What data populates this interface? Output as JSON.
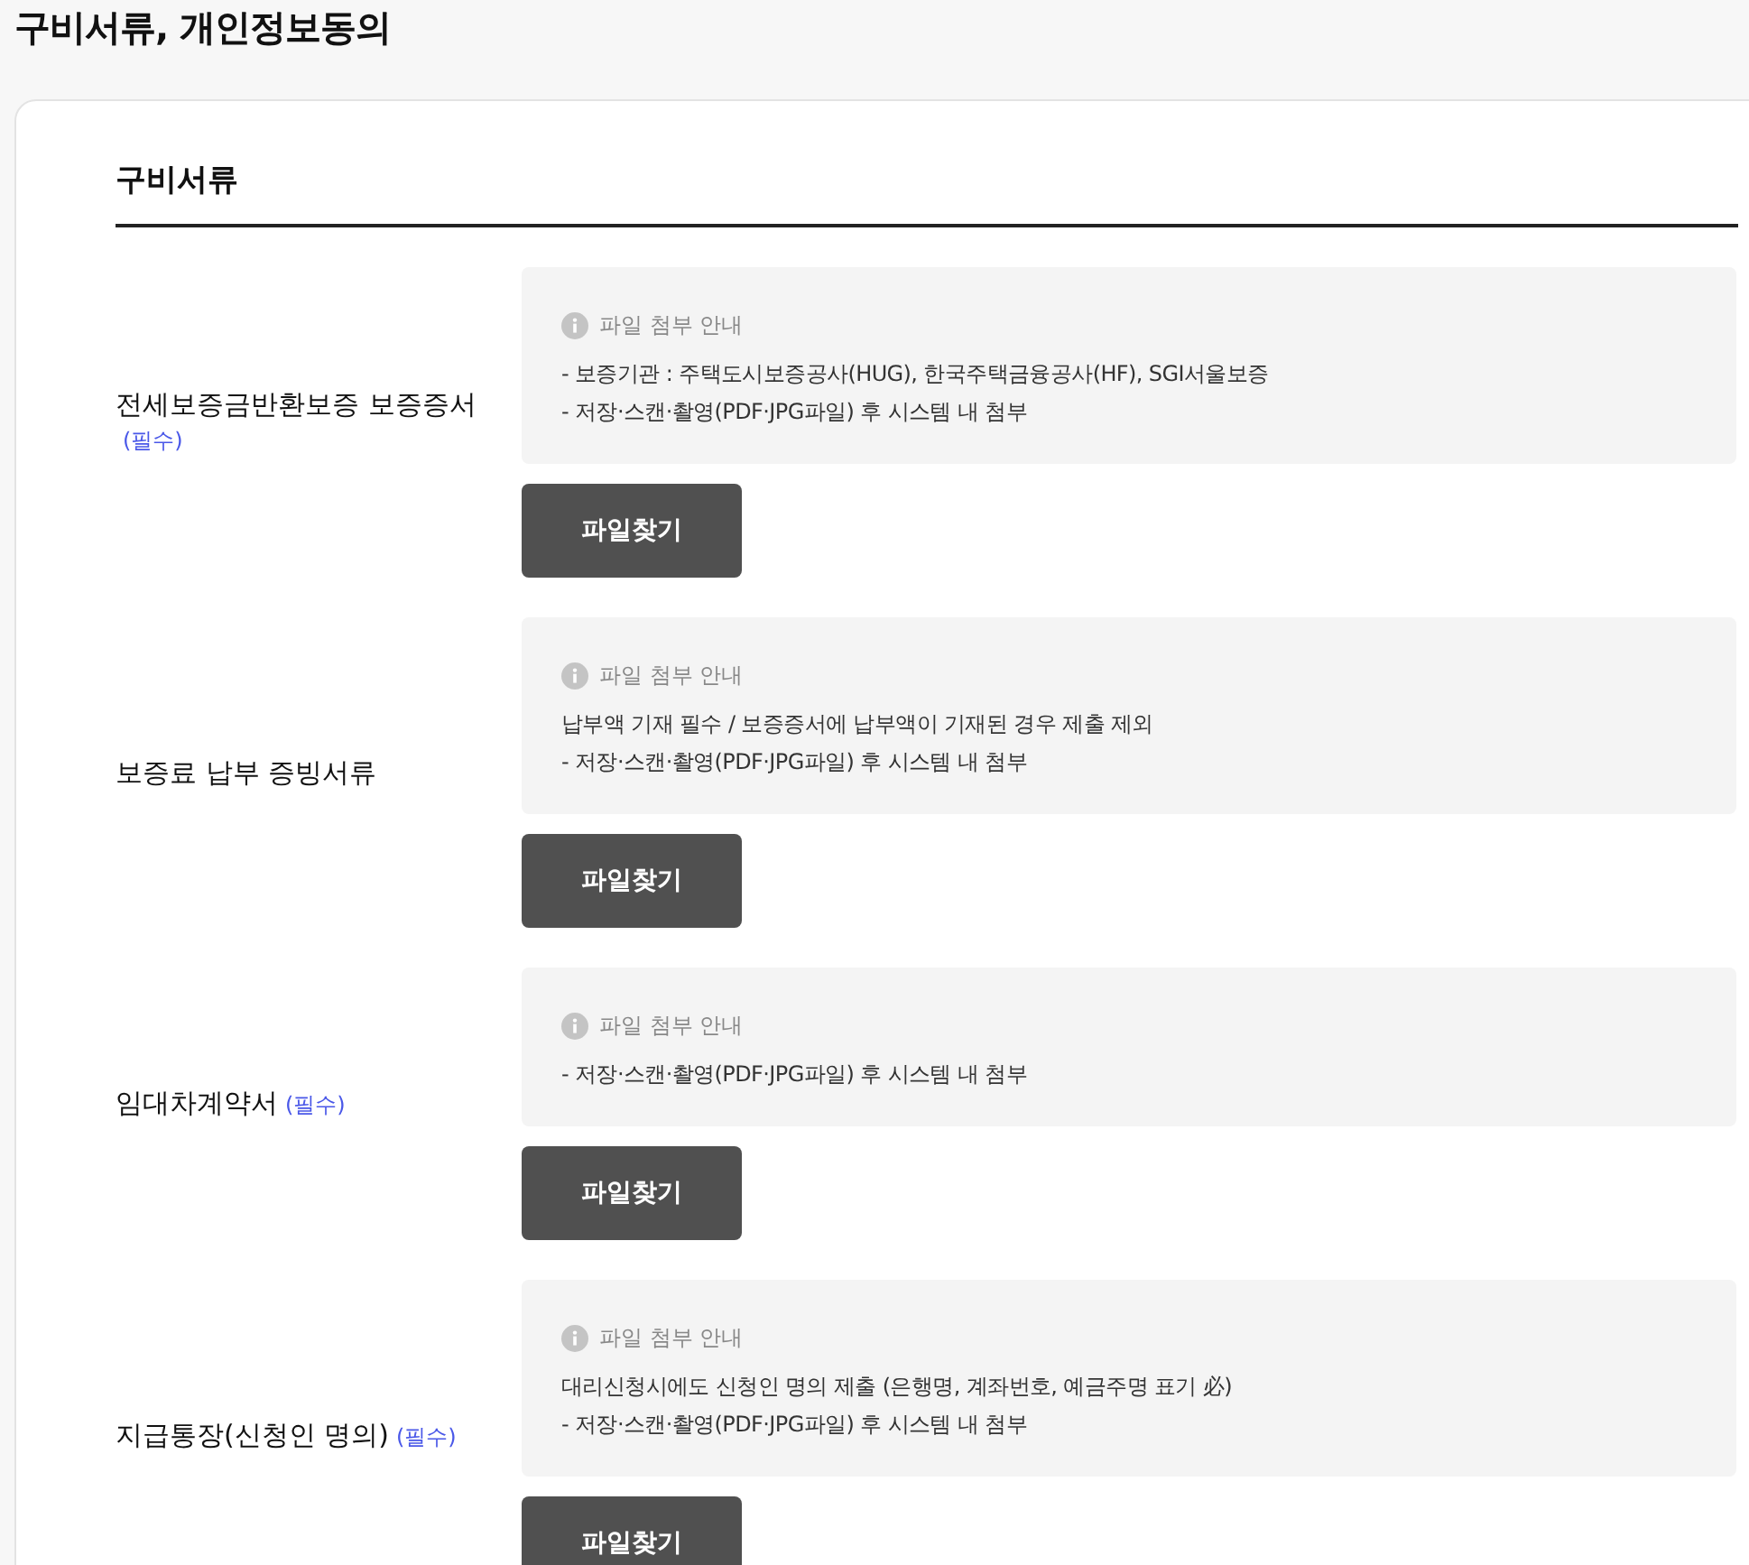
{
  "page_title": "구비서류, 개인정보동의",
  "section": {
    "title": "구비서류",
    "documents": [
      {
        "label": "전세보증금반환보증 보증증서",
        "required_mark": "(필수)",
        "notice": {
          "title": "파일 첨부 안내",
          "lines": [
            "- 보증기관 : 주택도시보증공사(HUG), 한국주택금융공사(HF), SGI서울보증",
            "- 저장·스캔·촬영(PDF·JPG파일) 후 시스템 내 첨부"
          ]
        },
        "button": "파일찾기"
      },
      {
        "label": "보증료 납부 증빙서류",
        "notice": {
          "title": "파일 첨부 안내",
          "lines": [
            "납부액 기재 필수 / 보증증서에 납부액이 기재된 경우 제출 제외",
            "- 저장·스캔·촬영(PDF·JPG파일) 후 시스템 내 첨부"
          ]
        },
        "button": "파일찾기"
      },
      {
        "label": "임대차계약서",
        "required_mark": "(필수)",
        "notice": {
          "title": "파일 첨부 안내",
          "lines": [
            "- 저장·스캔·촬영(PDF·JPG파일) 후 시스템 내 첨부"
          ]
        },
        "button": "파일찾기"
      },
      {
        "label": "지급통장(신청인 명의)",
        "required_mark": "(필수)",
        "notice": {
          "title": "파일 첨부 안내",
          "lines": [
            "대리신청시에도 신청인 명의 제출 (은행명, 계좌번호, 예금주명 표기 必)",
            "- 저장·스캔·촬영(PDF·JPG파일) 후 시스템 내 첨부"
          ]
        },
        "button": "파일찾기"
      }
    ]
  }
}
